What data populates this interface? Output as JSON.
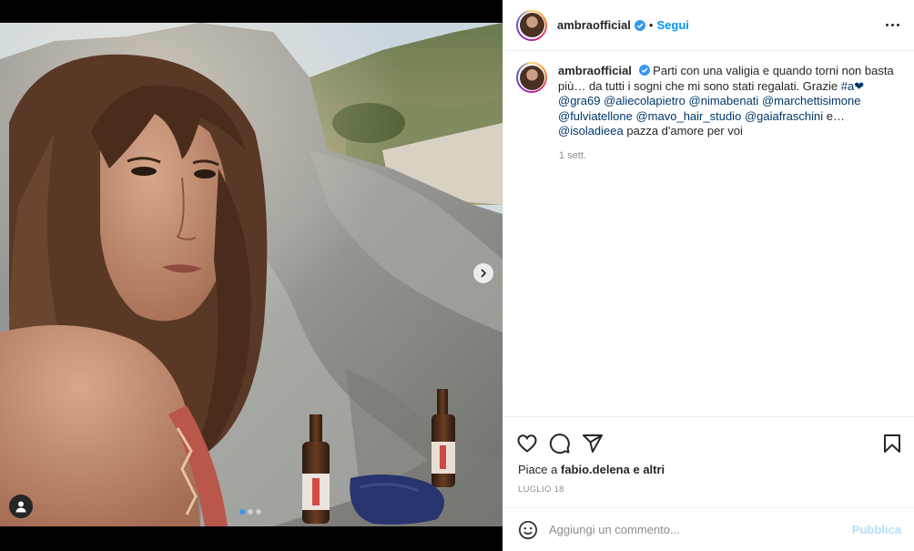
{
  "post": {
    "username": "ambraofficial",
    "separator": "•",
    "follow_label": "Segui",
    "verified_icon": "verified-badge-icon",
    "more_icon": "more-options-icon"
  },
  "caption": {
    "username": "ambraofficial",
    "text_1": "Parti con una valigia e quando torni non basta più… da tutti i sogni che mi sono stati regalati. Grazie ",
    "hashtag": "#a",
    "heart": "❤",
    "mentions": [
      "@gra69",
      "@aliecolapietro",
      "@nimabenati",
      "@marchettisimone",
      "@fulviatellone",
      "@mavo_hair_studio",
      "@gaiafraschini"
    ],
    "and_word": "e…",
    "last_mention": "@isoladieea",
    "text_2": "pazza d'amore per voi",
    "time_ago": "1 sett."
  },
  "actions": {
    "like_icon": "heart-icon",
    "comment_icon": "comment-icon",
    "share_icon": "share-icon",
    "save_icon": "bookmark-icon"
  },
  "likes": {
    "prefix": "Piace a",
    "user": "fabio.delena",
    "suffix": "e altri"
  },
  "date": "LUGLIO 18",
  "comment": {
    "emoji_icon": "emoji-icon",
    "placeholder": "Aggiungi un commento...",
    "publish_label": "Pubblica"
  },
  "carousel": {
    "total": 3,
    "active_index": 0,
    "next_icon": "chevron-right-icon",
    "tag_icon": "user-tag-icon"
  },
  "colors": {
    "accent": "#0095f6",
    "publish_disabled": "#b2dffc",
    "tag_link": "#00376b"
  }
}
